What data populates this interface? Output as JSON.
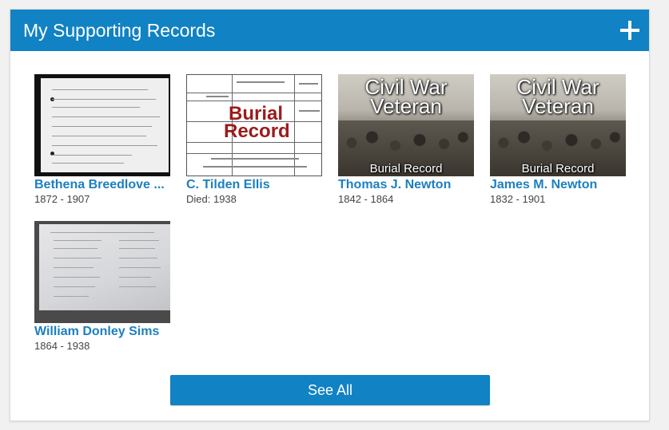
{
  "panel": {
    "title": "My Supporting Records",
    "add_icon": "plus-icon",
    "header_color": "#1182c3"
  },
  "records": [
    {
      "name": "Bethena Breedlove ...",
      "dates": "1872 - 1907",
      "thumbnail": "scanned-document"
    },
    {
      "name": "C. Tilden Ellis",
      "dates": "Died: 1938",
      "thumbnail": "burial-record-form",
      "thumb_text": "Burial Record"
    },
    {
      "name": "Thomas J. Newton",
      "dates": "1842 - 1864",
      "thumbnail": "civil-war-veteran",
      "thumb_title": "Civil War Veteran",
      "thumb_caption": "Burial Record"
    },
    {
      "name": "James M. Newton",
      "dates": "1832 - 1901",
      "thumbnail": "civil-war-veteran",
      "thumb_title": "Civil War Veteran",
      "thumb_caption": "Burial Record"
    },
    {
      "name": "William Donley Sims",
      "dates": "1864 - 1938",
      "thumbnail": "stone-plaque"
    }
  ],
  "footer": {
    "see_all_label": "See All"
  },
  "link_color": "#1c7fc0"
}
